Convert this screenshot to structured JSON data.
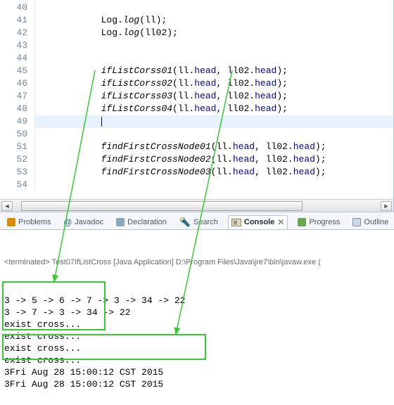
{
  "editor": {
    "lines": [
      {
        "n": 40,
        "indent": "            ",
        "raw": ""
      },
      {
        "n": 41,
        "indent": "            ",
        "call": "Log.",
        "italic": "log",
        "args": "(ll);"
      },
      {
        "n": 42,
        "indent": "            ",
        "call": "Log.",
        "italic": "log",
        "args": "(ll02);"
      },
      {
        "n": 43,
        "indent": "",
        "raw": ""
      },
      {
        "n": 44,
        "indent": "",
        "raw": ""
      },
      {
        "n": 45,
        "indent": "            ",
        "italic": "ifListCorss01",
        "args_open": "(ll.",
        "f1": "head",
        "mid": ", ll02.",
        "f2": "head",
        "close": ");"
      },
      {
        "n": 46,
        "indent": "            ",
        "italic": "ifListCorss02",
        "args_open": "(ll.",
        "f1": "head",
        "mid": ", ll02.",
        "f2": "head",
        "close": ");"
      },
      {
        "n": 47,
        "indent": "            ",
        "italic": "ifListCorss03",
        "args_open": "(ll.",
        "f1": "head",
        "mid": ", ll02.",
        "f2": "head",
        "close": ");"
      },
      {
        "n": 48,
        "indent": "            ",
        "italic": "ifListCorss04",
        "args_open": "(ll.",
        "f1": "head",
        "mid": ", ll02.",
        "f2": "head",
        "close": ");"
      },
      {
        "n": 49,
        "indent": "            ",
        "caret": true
      },
      {
        "n": 50,
        "indent": "",
        "raw": ""
      },
      {
        "n": 51,
        "indent": "            ",
        "italic": "findFirstCrossNode01",
        "args_open": "(ll.",
        "f1": "head",
        "mid": ", ll02.",
        "f2": "head",
        "close": ");"
      },
      {
        "n": 52,
        "indent": "            ",
        "italic": "findFirstCrossNode02",
        "args_open": "(ll.",
        "f1": "head",
        "mid": ", ll02.",
        "f2": "head",
        "close": ");"
      },
      {
        "n": 53,
        "indent": "            ",
        "italic": "findFirstCrossNode03",
        "args_open": "(ll.",
        "f1": "head",
        "mid": ", ll02.",
        "f2": "head",
        "close": ");"
      },
      {
        "n": 54,
        "indent": "",
        "raw": ""
      }
    ],
    "current_line": 49
  },
  "views": {
    "problems": "Problems",
    "javadoc": "Javadoc",
    "declaration": "Declaration",
    "search": "Search",
    "console": "Console",
    "progress": "Progress",
    "outline": "Outline"
  },
  "console": {
    "term_prefix": "<terminated>",
    "term_text": " Test07IfListCross [Java Application] D:\\Program Files\\Java\\jre7\\bin\\javaw.exe (",
    "lines": [
      "3 -> 5 -> 6 -> 7 -> 3 -> 34 -> 22",
      "3 -> 7 -> 3 -> 34 -> 22",
      "exist cross...",
      "exist cross...",
      "exist cross...",
      "exist cross...",
      "3Fri Aug 28 15:00:12 CST 2015",
      "3Fri Aug 28 15:00:12 CST 2015"
    ]
  }
}
